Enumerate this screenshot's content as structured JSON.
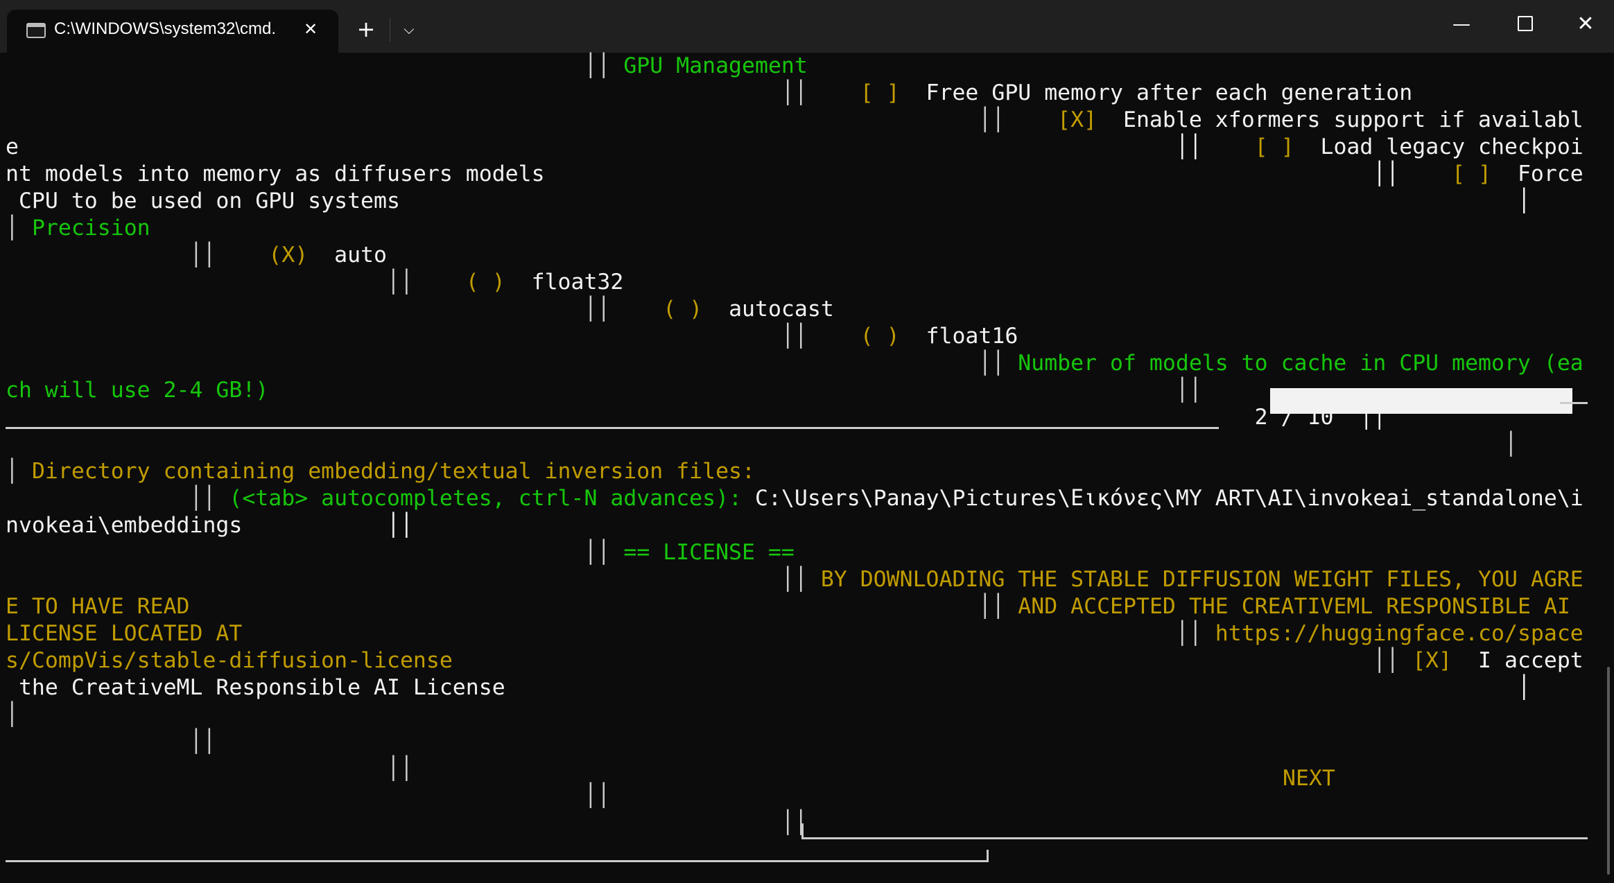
{
  "window": {
    "tab_title": "C:\\WINDOWS\\system32\\cmd.",
    "icons": {
      "tab": "terminal-icon",
      "close_tab": "close-icon",
      "new_tab": "plus-icon",
      "dropdown": "chevron-down-icon",
      "minimize": "minimize-icon",
      "maximize": "maximize-icon",
      "close": "close-icon"
    },
    "glyphs": {
      "close": "✕",
      "plus": "+",
      "chevron": "⌵",
      "minimize": "—"
    }
  },
  "colors": {
    "background": "#0c0c0c",
    "titlebar": "#202020",
    "text": "#cccccc",
    "green": "#16c60c",
    "yellow": "#c19c00"
  },
  "terminal": {
    "lines": [
      {
        "segs": [
          {
            "t": "                                            ││ ",
            "c": "d"
          },
          {
            "t": "GPU Management",
            "c": "g"
          }
        ]
      },
      {
        "segs": [
          {
            "t": "                                                           ││    ",
            "c": "d"
          },
          {
            "t": "[ ]",
            "c": "y"
          },
          {
            "t": "  Free GPU memory after each generation",
            "c": "w"
          }
        ]
      },
      {
        "segs": [
          {
            "t": "                                                                          ││    ",
            "c": "d"
          },
          {
            "t": "[X]",
            "c": "y"
          },
          {
            "t": "  Enable xformers support if availabl",
            "c": "w"
          }
        ]
      },
      {
        "segs": [
          {
            "t": "e                                                                                        ││    ",
            "c": "w"
          },
          {
            "t": "[ ]",
            "c": "y"
          },
          {
            "t": "  Load legacy checkpoi",
            "c": "w"
          }
        ]
      },
      {
        "segs": [
          {
            "t": "nt models into memory as diffusers models                                                               ││    ",
            "c": "w"
          },
          {
            "t": "[ ]",
            "c": "y"
          },
          {
            "t": "  Force",
            "c": "w"
          }
        ]
      },
      {
        "segs": [
          {
            "t": " CPU to be used on GPU systems                                                                                     │",
            "c": "w"
          }
        ]
      },
      {
        "segs": [
          {
            "t": "│ ",
            "c": "d"
          },
          {
            "t": "Precision",
            "c": "g"
          }
        ]
      },
      {
        "segs": [
          {
            "t": "              ││    ",
            "c": "d"
          },
          {
            "t": "(X)",
            "c": "y"
          },
          {
            "t": "  auto",
            "c": "w"
          }
        ]
      },
      {
        "segs": [
          {
            "t": "                             ││    ",
            "c": "d"
          },
          {
            "t": "( )",
            "c": "y"
          },
          {
            "t": "  float32",
            "c": "w"
          }
        ]
      },
      {
        "segs": [
          {
            "t": "                                            ││    ",
            "c": "d"
          },
          {
            "t": "( )",
            "c": "y"
          },
          {
            "t": "  autocast",
            "c": "w"
          }
        ]
      },
      {
        "segs": [
          {
            "t": "                                                           ││    ",
            "c": "d"
          },
          {
            "t": "( )",
            "c": "y"
          },
          {
            "t": "  float16",
            "c": "w"
          }
        ]
      },
      {
        "segs": [
          {
            "t": "                                                                          ││ ",
            "c": "d"
          },
          {
            "t": "Number of models to cache in CPU memory (ea",
            "c": "g"
          }
        ]
      },
      {
        "segs": [
          {
            "t": "ch will use 2-4 GB!)",
            "c": "g"
          },
          {
            "t": "                                                                     ││",
            "c": "d"
          }
        ]
      },
      {
        "segs": [
          {
            "t": "                                                                                               2 / 10  ││",
            "c": "w"
          }
        ]
      },
      {
        "segs": [
          {
            "t": "                                                                                                                  │",
            "c": "d"
          }
        ]
      },
      {
        "segs": [
          {
            "t": "│ ",
            "c": "d"
          },
          {
            "t": "Directory containing embedding/textual inversion files:",
            "c": "y"
          }
        ]
      },
      {
        "segs": [
          {
            "t": "              ││ ",
            "c": "d"
          },
          {
            "t": "(<tab> autocompletes, ctrl-N advances):",
            "c": "g"
          },
          {
            "t": " C:\\Users\\Panay\\Pictures\\Εικόνες\\MY ART\\AI\\invokeai_standalone\\i",
            "c": "w"
          }
        ]
      },
      {
        "segs": [
          {
            "t": "nvokeai\\embeddings           ││",
            "c": "w"
          }
        ]
      },
      {
        "segs": [
          {
            "t": "                                            ││ ",
            "c": "d"
          },
          {
            "t": "== LICENSE ==",
            "c": "g"
          }
        ]
      },
      {
        "segs": [
          {
            "t": "                                                           ││ ",
            "c": "d"
          },
          {
            "t": "BY DOWNLOADING THE STABLE DIFFUSION WEIGHT FILES, YOU AGRE",
            "c": "y"
          }
        ]
      },
      {
        "segs": [
          {
            "t": "E TO HAVE READ",
            "c": "y"
          },
          {
            "t": "                                                            ││ ",
            "c": "d"
          },
          {
            "t": "AND ACCEPTED THE CREATIVEML RESPONSIBLE AI",
            "c": "y"
          }
        ]
      },
      {
        "segs": [
          {
            "t": "LICENSE LOCATED AT",
            "c": "y"
          },
          {
            "t": "                                                                       ││ ",
            "c": "d"
          },
          {
            "t": "https://huggingface.co/space",
            "c": "y"
          }
        ]
      },
      {
        "segs": [
          {
            "t": "s/CompVis/stable-diffusion-license",
            "c": "y"
          },
          {
            "t": "                                                                      ││ ",
            "c": "d"
          },
          {
            "t": "[X]",
            "c": "y"
          },
          {
            "t": "  I accept",
            "c": "w"
          }
        ]
      },
      {
        "segs": [
          {
            "t": " the CreativeML Responsible AI License                                                                             │",
            "c": "w"
          }
        ]
      },
      {
        "segs": [
          {
            "t": "│",
            "c": "d"
          }
        ]
      },
      {
        "segs": [
          {
            "t": "              ││",
            "c": "d"
          }
        ]
      },
      {
        "segs": [
          {
            "t": "                             ││",
            "c": "d"
          }
        ]
      },
      {
        "segs": [
          {
            "t": "                                            ││",
            "c": "d"
          }
        ]
      },
      {
        "segs": [
          {
            "t": "                                                           ││",
            "c": "d"
          }
        ]
      }
    ],
    "next_label": "NEXT",
    "slider": {
      "value": 2,
      "max": 10
    }
  }
}
